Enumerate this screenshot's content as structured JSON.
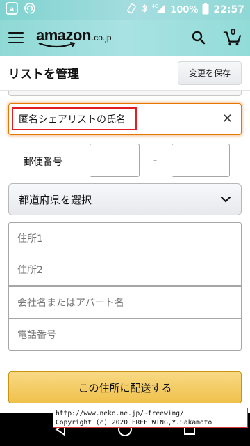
{
  "status_bar": {
    "time": "22:57",
    "battery_pct": "100%",
    "network": "4G",
    "icons": [
      "notification-a-icon",
      "cast-icon",
      "rotate-icon",
      "bluetooth-icon",
      "signal-icon",
      "battery-icon"
    ]
  },
  "header": {
    "logo_text": "amazon",
    "logo_suffix": ".co.jp",
    "cart_count": "0",
    "icons": [
      "hamburger-menu-icon",
      "search-icon",
      "cart-icon"
    ]
  },
  "title_bar": {
    "title": "リストを管理",
    "save_label": "変更を保存"
  },
  "form": {
    "name_value": "匿名シェアリストの氏名",
    "clear_glyph": "✕",
    "zip_label": "郵便番号",
    "zip_separator": "-",
    "prefecture_placeholder": "都道府県を選択",
    "address1_placeholder": "住所1",
    "address2_placeholder": "住所2",
    "company_placeholder": "会社名またはアパート名",
    "phone_placeholder": "電話番号",
    "ship_button_label": "この住所に配送する"
  },
  "watermark": {
    "line1": "http://www.neko.ne.jp/~freewing/",
    "line2": "Copyright (c) 2020 FREE WING,Y.Sakamoto"
  },
  "colors": {
    "header_teal": "#92dcd8",
    "focus_orange": "#e77600",
    "highlight_red": "#e01e26",
    "button_yellow": "#f0c14b"
  }
}
